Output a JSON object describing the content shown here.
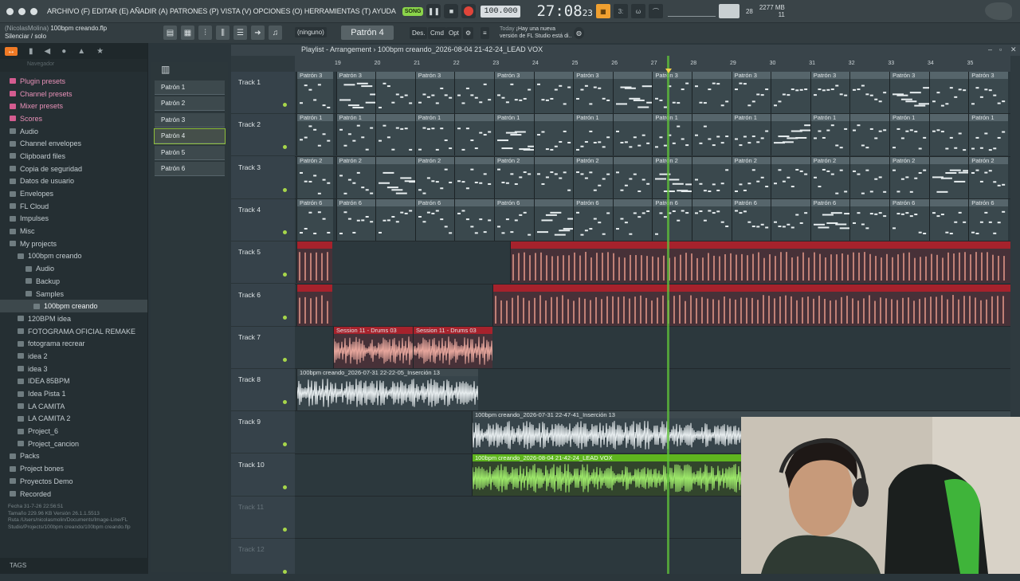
{
  "menubar": {
    "menu_text": "ARCHIVO (F) EDITAR (E) AÑADIR (A) PATRONES (P) VISTA (V) OPCIONES (O) HERRAMIENTAS (T) AYUDA",
    "song_label": "SONG",
    "tempo": "100.000",
    "clock_main": "27:08",
    "clock_small": "23",
    "cpu_value": "28",
    "memory": "2277 MB",
    "memory_sub": "11"
  },
  "subbar": {
    "user": "(NicolasMolina)",
    "file": "100bpm creando.flp",
    "hint": "Silenciar / solo",
    "none_select": "(ninguno)",
    "pattern_select": "Patrón 4",
    "btn_des": "Des.",
    "btn_cmd": "Cmd",
    "btn_opt": "Opt",
    "news_day": "Today",
    "news_line1": "¡Hay una nueva",
    "news_line2": "versión de FL Studio está di.."
  },
  "browser": {
    "search_placeholder": "Navegador",
    "items": [
      {
        "label": "Plugin presets",
        "style": "pink",
        "indent": 0
      },
      {
        "label": "Channel presets",
        "style": "pink",
        "indent": 0
      },
      {
        "label": "Mixer presets",
        "style": "pink",
        "indent": 0
      },
      {
        "label": "Scores",
        "style": "pink",
        "indent": 0
      },
      {
        "label": "Audio",
        "style": "",
        "indent": 0
      },
      {
        "label": "Channel envelopes",
        "style": "",
        "indent": 0
      },
      {
        "label": "Clipboard files",
        "style": "",
        "indent": 0
      },
      {
        "label": "Copia de seguridad",
        "style": "",
        "indent": 0
      },
      {
        "label": "Datos de usuario",
        "style": "",
        "indent": 0
      },
      {
        "label": "Envelopes",
        "style": "",
        "indent": 0
      },
      {
        "label": "FL Cloud",
        "style": "",
        "indent": 0
      },
      {
        "label": "Impulses",
        "style": "",
        "indent": 0
      },
      {
        "label": "Misc",
        "style": "",
        "indent": 0
      },
      {
        "label": "My projects",
        "style": "",
        "indent": 0
      },
      {
        "label": "100bpm creando",
        "style": "",
        "indent": 1
      },
      {
        "label": "Audio",
        "style": "",
        "indent": 2
      },
      {
        "label": "Backup",
        "style": "",
        "indent": 2
      },
      {
        "label": "Samples",
        "style": "",
        "indent": 2
      },
      {
        "label": "100bpm creando",
        "style": "sel",
        "indent": 3
      },
      {
        "label": "120BPM idea",
        "style": "",
        "indent": 1
      },
      {
        "label": "FOTOGRAMA OFICIAL REMAKE",
        "style": "",
        "indent": 1
      },
      {
        "label": "fotograma recrear",
        "style": "",
        "indent": 1
      },
      {
        "label": "idea 2",
        "style": "",
        "indent": 1
      },
      {
        "label": "idea 3",
        "style": "",
        "indent": 1
      },
      {
        "label": "IDEA 85BPM",
        "style": "",
        "indent": 1
      },
      {
        "label": "Idea Pista 1",
        "style": "",
        "indent": 1
      },
      {
        "label": "LA CAMITA",
        "style": "",
        "indent": 1
      },
      {
        "label": "LA CAMITA 2",
        "style": "",
        "indent": 1
      },
      {
        "label": "Project_6",
        "style": "",
        "indent": 1
      },
      {
        "label": "Project_cancion",
        "style": "",
        "indent": 1
      },
      {
        "label": "Packs",
        "style": "",
        "indent": 0
      },
      {
        "label": "Project bones",
        "style": "",
        "indent": 0
      },
      {
        "label": "Proyectos Demo",
        "style": "",
        "indent": 0
      },
      {
        "label": "Recorded",
        "style": "",
        "indent": 0
      }
    ],
    "info_fecha": "Fecha      31-7-26 22:56:51",
    "info_tamano": "Tamaño 229.96 KB   Versión  26.1.1.5513",
    "info_ruta": "Ruta         /Users/nicolasmolin/Documents/Image-Line/FL Studio/Projects/100bpm creando/100bpm creando.flp",
    "tags_label": "TAGS"
  },
  "patterns": [
    "Patrón 1",
    "Patrón 2",
    "Patrón 3",
    "Patrón 4",
    "Patrón 5",
    "Patrón 6"
  ],
  "playlist": {
    "title": "Playlist - Arrangement  ›  100bpm creando_2026-08-04 21-42-24_LEAD VOX",
    "ruler": [
      "19",
      "20",
      "21",
      "22",
      "23",
      "24",
      "25",
      "26",
      "27",
      "28",
      "29",
      "30",
      "31",
      "32",
      "33",
      "34",
      "35"
    ],
    "tracks": [
      "Track 1",
      "Track 2",
      "Track 3",
      "Track 4",
      "Track 5",
      "Track 6",
      "Track 7",
      "Track 8",
      "Track 9",
      "Track 10",
      "Track 11",
      "Track 12"
    ],
    "clip_labels": {
      "p3": "Patrón 3",
      "p1": "Patrón 1",
      "p2": "Patrón 2",
      "p6": "Patrón 6",
      "drums": "Session 11 - Drums 03",
      "ins13a": "100bpm creando_2026-07-31 22-22-05_Inserción 13",
      "ins13b": "100bpm creando_2026-07-31 22-47-41_Inserción 13",
      "leadvox": "100bpm creando_2026-08-04 21-42-24_LEAD VOX"
    }
  }
}
